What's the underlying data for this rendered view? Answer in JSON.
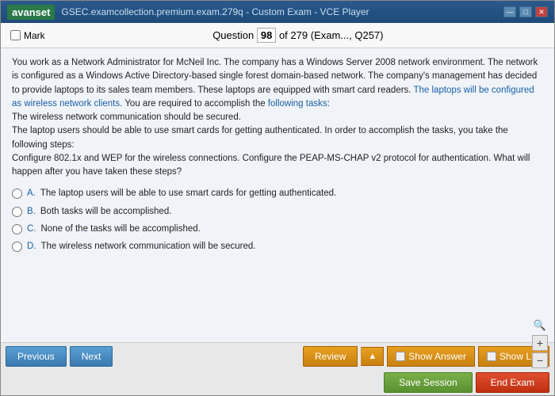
{
  "titleBar": {
    "logo": "avanset",
    "title": "GSEC.examcollection.premium.exam.279q - Custom Exam - VCE Player",
    "controls": [
      "minimize",
      "maximize",
      "close"
    ]
  },
  "header": {
    "markLabel": "Mark",
    "questionLabel": "Question",
    "questionNumber": "98",
    "totalQuestions": "of 279",
    "examInfo": "(Exam..., Q257)"
  },
  "question": {
    "body": "You work as a Network Administrator for McNeil Inc. The company has a Windows Server 2008 network environment. The network is configured as a Windows Active Directory-based single forest domain-based network. The company's management has decided to provide laptops to its sales team members. These laptops are equipped with smart card readers. The laptops will be configured as wireless network clients. You are required to accomplish the following tasks:",
    "tasks": "The wireless network communication should be secured.",
    "laptopTask": "The laptop users should be able to use smart cards for getting authenticated. In order to accomplish the tasks, you take the following steps:",
    "steps": "Configure 802.1x and WEP for the wireless connections. Configure the PEAP-MS-CHAP v2 protocol for authentication. What will happen after you have taken these steps?",
    "answers": [
      {
        "id": "A",
        "text": "The laptop users will be able to use smart cards for getting authenticated."
      },
      {
        "id": "B",
        "text": "Both tasks will be accomplished."
      },
      {
        "id": "C",
        "text": "None of the tasks will be accomplished."
      },
      {
        "id": "D",
        "text": "The wireless network communication will be secured."
      }
    ]
  },
  "toolbar": {
    "previousLabel": "Previous",
    "nextLabel": "Next",
    "reviewLabel": "Review",
    "showAnswerLabel": "Show Answer",
    "showListLabel": "Show List",
    "saveSessionLabel": "Save Session",
    "endExamLabel": "End Exam"
  },
  "zoom": {
    "plusLabel": "+",
    "minusLabel": "−"
  }
}
